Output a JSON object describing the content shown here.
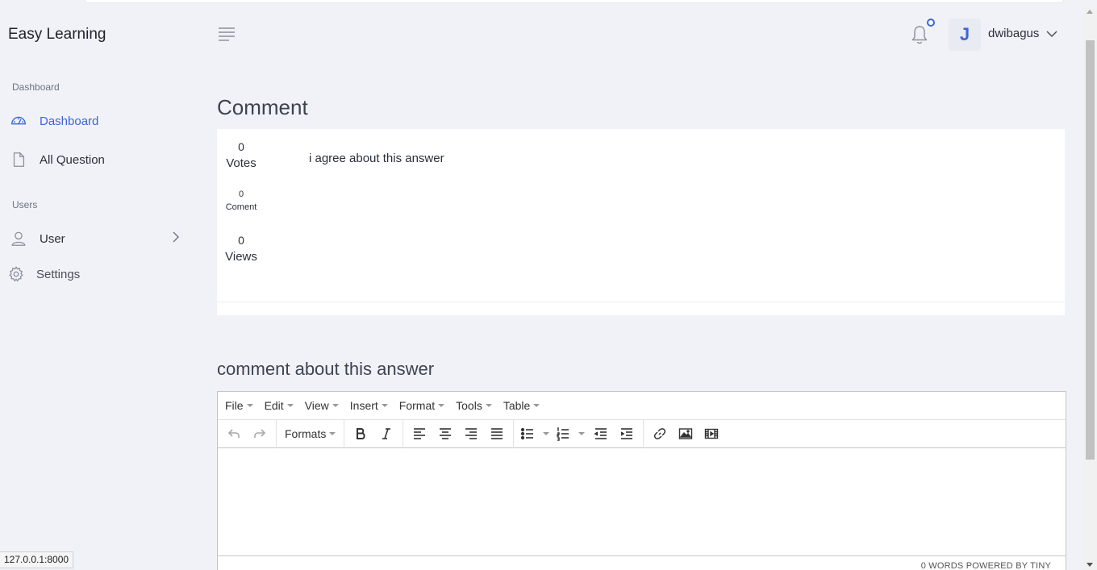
{
  "app": {
    "brand": "Easy Learning"
  },
  "sidebar": {
    "sections": [
      {
        "label": "Dashboard"
      },
      {
        "label": "Users"
      }
    ],
    "items": [
      {
        "label": "Dashboard",
        "icon": "gauge-icon",
        "active": true
      },
      {
        "label": "All Question",
        "icon": "file-icon"
      },
      {
        "label": "User",
        "icon": "user-icon"
      },
      {
        "label": "Settings",
        "icon": "gear-icon"
      }
    ]
  },
  "header": {
    "avatar_initial": "J",
    "username": "dwibagus"
  },
  "page": {
    "title": "Comment",
    "card": {
      "votes_count": "0",
      "votes_label": "Votes",
      "comment_count": "0",
      "comment_label": "Coment",
      "views_count": "0",
      "views_label": "Views",
      "text": "i agree about this answer"
    },
    "form_title": "comment about this answer"
  },
  "editor": {
    "menus": [
      "File",
      "Edit",
      "View",
      "Insert",
      "Format",
      "Tools",
      "Table"
    ],
    "formats_label": "Formats",
    "status": "0 WORDS POWERED BY TINY"
  },
  "browser": {
    "status_url": "127.0.0.1:8000"
  },
  "colors": {
    "accent": "#3b66d6",
    "background": "#f1f2f7"
  }
}
